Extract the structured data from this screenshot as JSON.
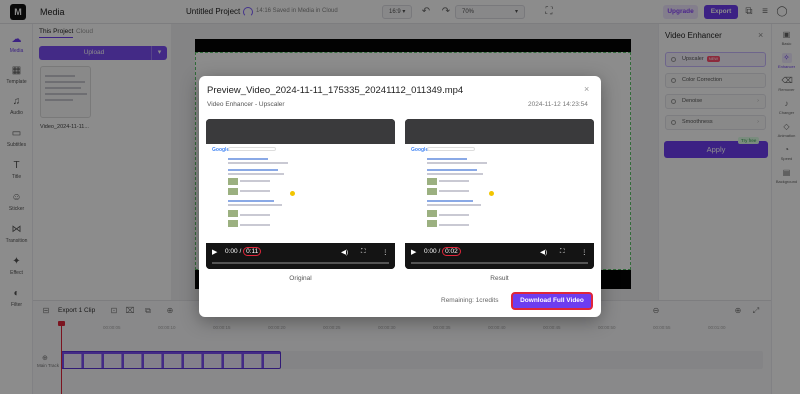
{
  "topbar": {
    "media_title": "Media",
    "project_name": "Untitled Project",
    "save_status": "14:16 Saved in Media in Cloud",
    "aspect_ratio": "16:9",
    "zoom": "70%",
    "upgrade_label": "Upgrade",
    "export_label": "Export"
  },
  "leftrail": {
    "items": [
      {
        "label": "Media",
        "icon": "media-icon"
      },
      {
        "label": "Template",
        "icon": "template-icon"
      },
      {
        "label": "Audio",
        "icon": "audio-icon"
      },
      {
        "label": "Subtitles",
        "icon": "subtitles-icon"
      },
      {
        "label": "Title",
        "icon": "title-icon"
      },
      {
        "label": "Sticker",
        "icon": "sticker-icon"
      },
      {
        "label": "Transition",
        "icon": "transition-icon"
      },
      {
        "label": "Effect",
        "icon": "effect-icon"
      },
      {
        "label": "Filter",
        "icon": "filter-icon"
      }
    ]
  },
  "mediapanel": {
    "tab_project": "This Project",
    "tab_cloud": "Cloud",
    "upload_label": "Upload",
    "file_name": "Video_2024-11-11..."
  },
  "rightpanel": {
    "title": "Video Enhancer",
    "options": [
      {
        "label": "Upscaler",
        "badge": "NEW"
      },
      {
        "label": "Color Correction"
      },
      {
        "label": "Denoise"
      },
      {
        "label": "Smoothness"
      }
    ],
    "apply_label": "Apply",
    "try_free": "Try free"
  },
  "rightrail": {
    "items": [
      {
        "label": "Basic"
      },
      {
        "label": "Enhancer"
      },
      {
        "label": "Remover"
      },
      {
        "label": "Changer"
      },
      {
        "label": "Animation"
      },
      {
        "label": "Speed"
      },
      {
        "label": "Background"
      }
    ]
  },
  "timeline": {
    "export_clip_label": "Export 1 Clip",
    "ruler": [
      "00:00:00",
      "00:00:05",
      "00:00:10",
      "00:00:15",
      "00:00:20",
      "00:00:25",
      "00:00:30",
      "00:00:35",
      "00:00:40",
      "00:00:45",
      "00:00:50",
      "00:00:55",
      "00:01:00"
    ],
    "main_track_label": "Main Track"
  },
  "modal": {
    "title": "Preview_Video_2024-11-11_175335_20241112_011349.mp4",
    "subtitle": "Video Enhancer - Upscaler",
    "timestamp": "2024-11-12 14:23:54",
    "original": {
      "caption": "Original",
      "time": "0:00",
      "duration": "0:11",
      "progress": 0.0
    },
    "result": {
      "caption": "Result",
      "time": "0:00",
      "duration": "0:02",
      "progress": 0.0
    },
    "remaining": "Remaining: 1credits",
    "download_label": "Download Full Video"
  },
  "colors": {
    "accent": "#6d3df0",
    "highlight": "#e0263a"
  }
}
